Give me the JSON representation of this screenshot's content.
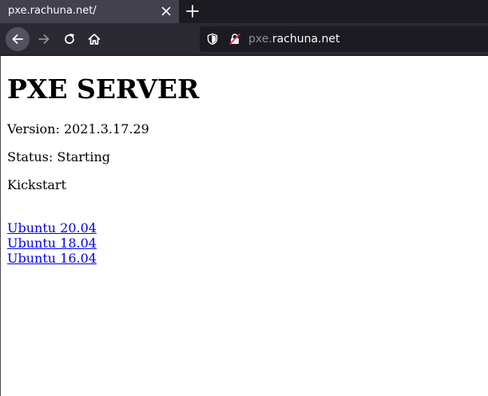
{
  "browser": {
    "tab_title": "pxe.rachuna.net/",
    "url_prefix": "pxe.",
    "url_host": "rachuna.net",
    "colors": {
      "tab_bg": "#42414d",
      "toolbar_bg": "#2b2a33",
      "urlbar_bg": "#1c1b22"
    }
  },
  "page": {
    "title": "PXE SERVER",
    "version_label": "Version: 2021.3.17.29",
    "status_label": "Status: Starting",
    "section_label": "Kickstart",
    "links": [
      {
        "label": "Ubuntu 20.04"
      },
      {
        "label": "Ubuntu 18.04"
      },
      {
        "label": "Ubuntu 16.04"
      }
    ],
    "colors": {
      "link": "#0000ee"
    }
  }
}
